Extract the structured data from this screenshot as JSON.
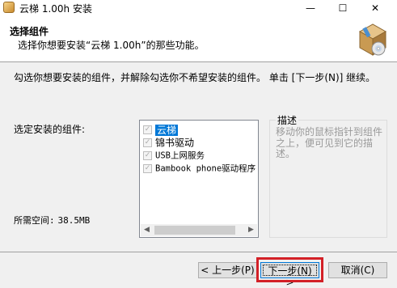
{
  "window": {
    "title": "云梯 1.00h 安装",
    "icon": "installer-app-icon",
    "controls": {
      "minimize": "—",
      "maximize": "☐",
      "close": "✕"
    }
  },
  "header": {
    "title": "选择组件",
    "subtitle": "选择你想要安装“云梯 1.00h”的那些功能。",
    "icon": "package-box-cd-icon"
  },
  "instructions": "勾选你想要安装的组件，并解除勾选你不希望安装的组件。 单击 [下一步(N)] 继续。",
  "components": {
    "label": "选定安装的组件:",
    "items": [
      {
        "label": "云梯",
        "checked": true,
        "selected": true
      },
      {
        "label": "锦书驱动",
        "checked": true,
        "selected": false
      },
      {
        "label": "USB上网服务",
        "checked": true,
        "selected": false
      },
      {
        "label": "Bambook phone驱动程序",
        "checked": true,
        "selected": false
      }
    ]
  },
  "space": {
    "label": "所需空间:",
    "value": "38.5MB"
  },
  "description": {
    "title": "描述",
    "text": "移动你的鼠标指针到组件之上，便可见到它的描述。"
  },
  "buttons": {
    "back": "< 上一步(P)",
    "next": "下一步(N) >",
    "cancel": "取消(C)"
  },
  "colors": {
    "highlight": "#d32027",
    "selection": "#0078d7"
  }
}
